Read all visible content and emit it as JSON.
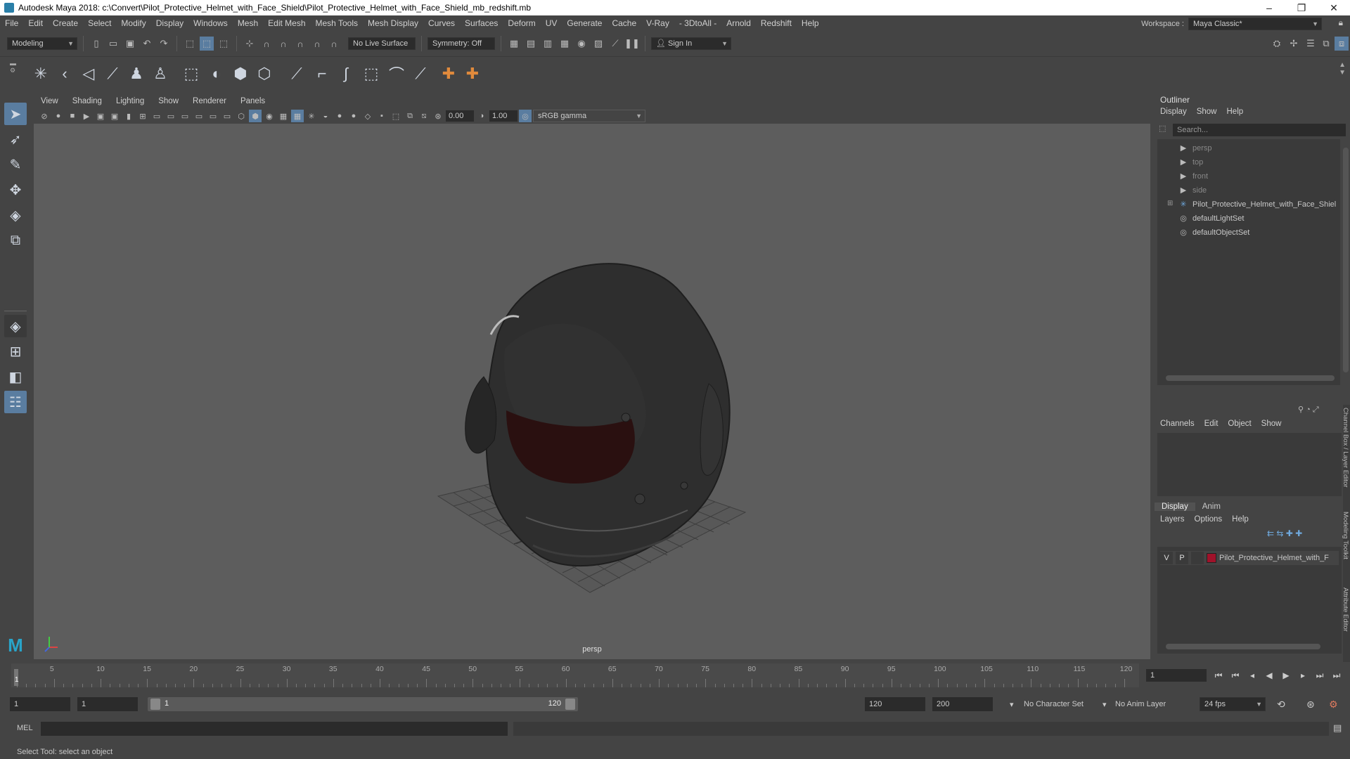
{
  "titlebar": {
    "title": "Autodesk Maya 2018: c:\\Convert\\Pilot_Protective_Helmet_with_Face_Shield\\Pilot_Protective_Helmet_with_Face_Shield_mb_redshift.mb",
    "minimize": "–",
    "maximize": "❐",
    "close": "✕"
  },
  "menubar": {
    "items": [
      "File",
      "Edit",
      "Create",
      "Select",
      "Modify",
      "Display",
      "Windows",
      "Mesh",
      "Edit Mesh",
      "Mesh Tools",
      "Mesh Display",
      "Curves",
      "Surfaces",
      "Deform",
      "UV",
      "Generate",
      "Cache",
      "V-Ray",
      "- 3DtoAll -",
      "Arnold",
      "Redshift",
      "Help"
    ],
    "workspace_label": "Workspace :",
    "workspace_value": "Maya Classic*"
  },
  "statusline": {
    "mode": "Modeling",
    "live_surface": "No Live Surface",
    "symmetry": "Symmetry: Off",
    "sign_in": "Sign In"
  },
  "viewport": {
    "menus": [
      "View",
      "Shading",
      "Lighting",
      "Show",
      "Renderer",
      "Panels"
    ],
    "exposure": "0.00",
    "gamma": "1.00",
    "color_space": "sRGB gamma",
    "camera_label": "persp"
  },
  "outliner": {
    "title": "Outliner",
    "menus": [
      "Display",
      "Show",
      "Help"
    ],
    "search_placeholder": "Search...",
    "items": [
      {
        "label": "persp",
        "icon": "camera-icon",
        "dim": true
      },
      {
        "label": "top",
        "icon": "camera-icon",
        "dim": true
      },
      {
        "label": "front",
        "icon": "camera-icon",
        "dim": true
      },
      {
        "label": "side",
        "icon": "camera-icon",
        "dim": true
      },
      {
        "label": "Pilot_Protective_Helmet_with_Face_Shiel",
        "icon": "transform-icon",
        "dim": false
      },
      {
        "label": "defaultLightSet",
        "icon": "set-icon",
        "dim": false
      },
      {
        "label": "defaultObjectSet",
        "icon": "set-icon",
        "dim": false
      }
    ]
  },
  "channelbox": {
    "menus": [
      "Channels",
      "Edit",
      "Object",
      "Show"
    ]
  },
  "layereditor": {
    "tabs": [
      "Display",
      "Anim"
    ],
    "menus": [
      "Layers",
      "Options",
      "Help"
    ],
    "layer": {
      "v": "V",
      "p": "P",
      "name": "Pilot_Protective_Helmet_with_F",
      "color": "#a0122a"
    }
  },
  "sidetabs": [
    "Channel Box / Layer Editor",
    "Modeling Toolkit",
    "Attribute Editor"
  ],
  "timeline": {
    "ticks": [
      1,
      5,
      10,
      15,
      20,
      25,
      30,
      35,
      40,
      45,
      50,
      55,
      60,
      65,
      70,
      75,
      80,
      85,
      90,
      95,
      100,
      105,
      110,
      115,
      120
    ],
    "current_frame": "1",
    "current_marker": "1"
  },
  "range": {
    "start": "1",
    "anim_start": "1",
    "slider_start": "1",
    "slider_end": "120",
    "anim_end": "120",
    "end": "200",
    "character_set": "No Character Set",
    "anim_layer": "No Anim Layer",
    "fps": "24 fps"
  },
  "cmdline": {
    "lang": "MEL"
  },
  "help_line": "Select Tool: select an object"
}
